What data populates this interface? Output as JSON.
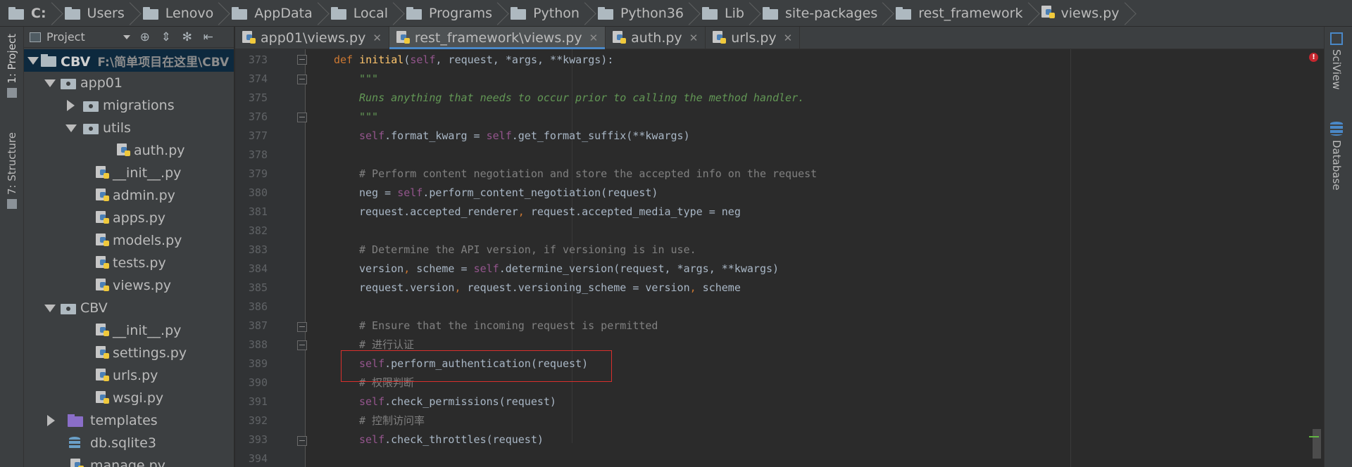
{
  "breadcrumb": {
    "items": [
      {
        "label": "C:",
        "icon": "folder-icon",
        "bold": true
      },
      {
        "label": "Users",
        "icon": "folder-icon"
      },
      {
        "label": "Lenovo",
        "icon": "folder-icon"
      },
      {
        "label": "AppData",
        "icon": "folder-icon"
      },
      {
        "label": "Local",
        "icon": "folder-icon"
      },
      {
        "label": "Programs",
        "icon": "folder-icon"
      },
      {
        "label": "Python",
        "icon": "folder-icon"
      },
      {
        "label": "Python36",
        "icon": "folder-icon"
      },
      {
        "label": "Lib",
        "icon": "folder-icon"
      },
      {
        "label": "site-packages",
        "icon": "folder-icon"
      },
      {
        "label": "rest_framework",
        "icon": "folder-icon"
      },
      {
        "label": "views.py",
        "icon": "python-file-icon"
      }
    ]
  },
  "left_strip": {
    "project_tab": "1: Project",
    "structure_tab": "7: Structure"
  },
  "right_strip": {
    "sciview_tab": "SciView",
    "database_tab": "Database"
  },
  "project_panel": {
    "view_label": "Project",
    "tree": [
      {
        "label": "CBV",
        "path": "F:\\简单项目在这里\\CBV",
        "type": "project",
        "expanded": true
      },
      {
        "label": "app01",
        "type": "package",
        "expanded": true
      },
      {
        "label": "migrations",
        "type": "package",
        "expanded": false
      },
      {
        "label": "utils",
        "type": "package",
        "expanded": true
      },
      {
        "label": "auth.py",
        "type": "python"
      },
      {
        "label": "__init__.py",
        "type": "python"
      },
      {
        "label": "admin.py",
        "type": "python"
      },
      {
        "label": "apps.py",
        "type": "python"
      },
      {
        "label": "models.py",
        "type": "python"
      },
      {
        "label": "tests.py",
        "type": "python"
      },
      {
        "label": "views.py",
        "type": "python"
      },
      {
        "label": "CBV",
        "type": "package",
        "expanded": true
      },
      {
        "label": "__init__.py",
        "type": "python"
      },
      {
        "label": "settings.py",
        "type": "python"
      },
      {
        "label": "urls.py",
        "type": "python"
      },
      {
        "label": "wsgi.py",
        "type": "python"
      },
      {
        "label": "templates",
        "type": "templates",
        "expanded": false
      },
      {
        "label": "db.sqlite3",
        "type": "database"
      },
      {
        "label": "manage.py",
        "type": "python"
      }
    ]
  },
  "editor_tabs": [
    {
      "label": "app01\\views.py",
      "active": false
    },
    {
      "label": "rest_framework\\views.py",
      "active": true
    },
    {
      "label": "auth.py",
      "active": false
    },
    {
      "label": "urls.py",
      "active": false
    }
  ],
  "editor": {
    "line_numbers": [
      "373",
      "374",
      "375",
      "376",
      "377",
      "378",
      "379",
      "380",
      "381",
      "382",
      "383",
      "384",
      "385",
      "386",
      "387",
      "388",
      "389",
      "390",
      "391",
      "392",
      "393",
      "394"
    ],
    "colors": {
      "keyword": "#cc7832",
      "function": "#ffc66d",
      "self": "#94558d",
      "comment": "#808080",
      "docstring": "#629755",
      "highlight_box": "#d9302c"
    }
  },
  "code": {
    "l373": {
      "kw": "def ",
      "fn": "initial",
      "a": "(",
      "s": "self",
      "b": ", request, *args, **kwargs):"
    },
    "l374": "\"\"\"",
    "l375": "Runs anything that needs to occur prior to calling the method handler.",
    "l376": "\"\"\"",
    "l377": {
      "s1": "self",
      "a": ".format_kwarg = ",
      "s2": "self",
      "b": ".get_format_suffix(**kwargs)"
    },
    "l379": "# Perform content negotiation and store the accepted info on the request",
    "l380": {
      "a": "neg = ",
      "s": "self",
      "b": ".perform_content_negotiation(request)"
    },
    "l381": {
      "a": "request.accepted_renderer",
      "c": ", ",
      "b": "request.accepted_media_type = neg"
    },
    "l383": "# Determine the API version, if versioning is in use.",
    "l384": {
      "a": "version",
      "c": ", ",
      "b": "scheme = ",
      "s": "self",
      "d": ".determine_version(request, *args, **kwargs)"
    },
    "l385": {
      "a": "request.version",
      "c": ", ",
      "b": "request.versioning_scheme = version",
      "c2": ", ",
      "d": "scheme"
    },
    "l387": "# Ensure that the incoming request is permitted",
    "l388": "# 进行认证",
    "l389": {
      "s": "self",
      "b": ".perform_authentication(request)"
    },
    "l390": "# 权限判断",
    "l391": {
      "s": "self",
      "b": ".check_permissions(request)"
    },
    "l392": "# 控制访问率",
    "l393": {
      "s": "self",
      "b": ".check_throttles(request)"
    }
  }
}
